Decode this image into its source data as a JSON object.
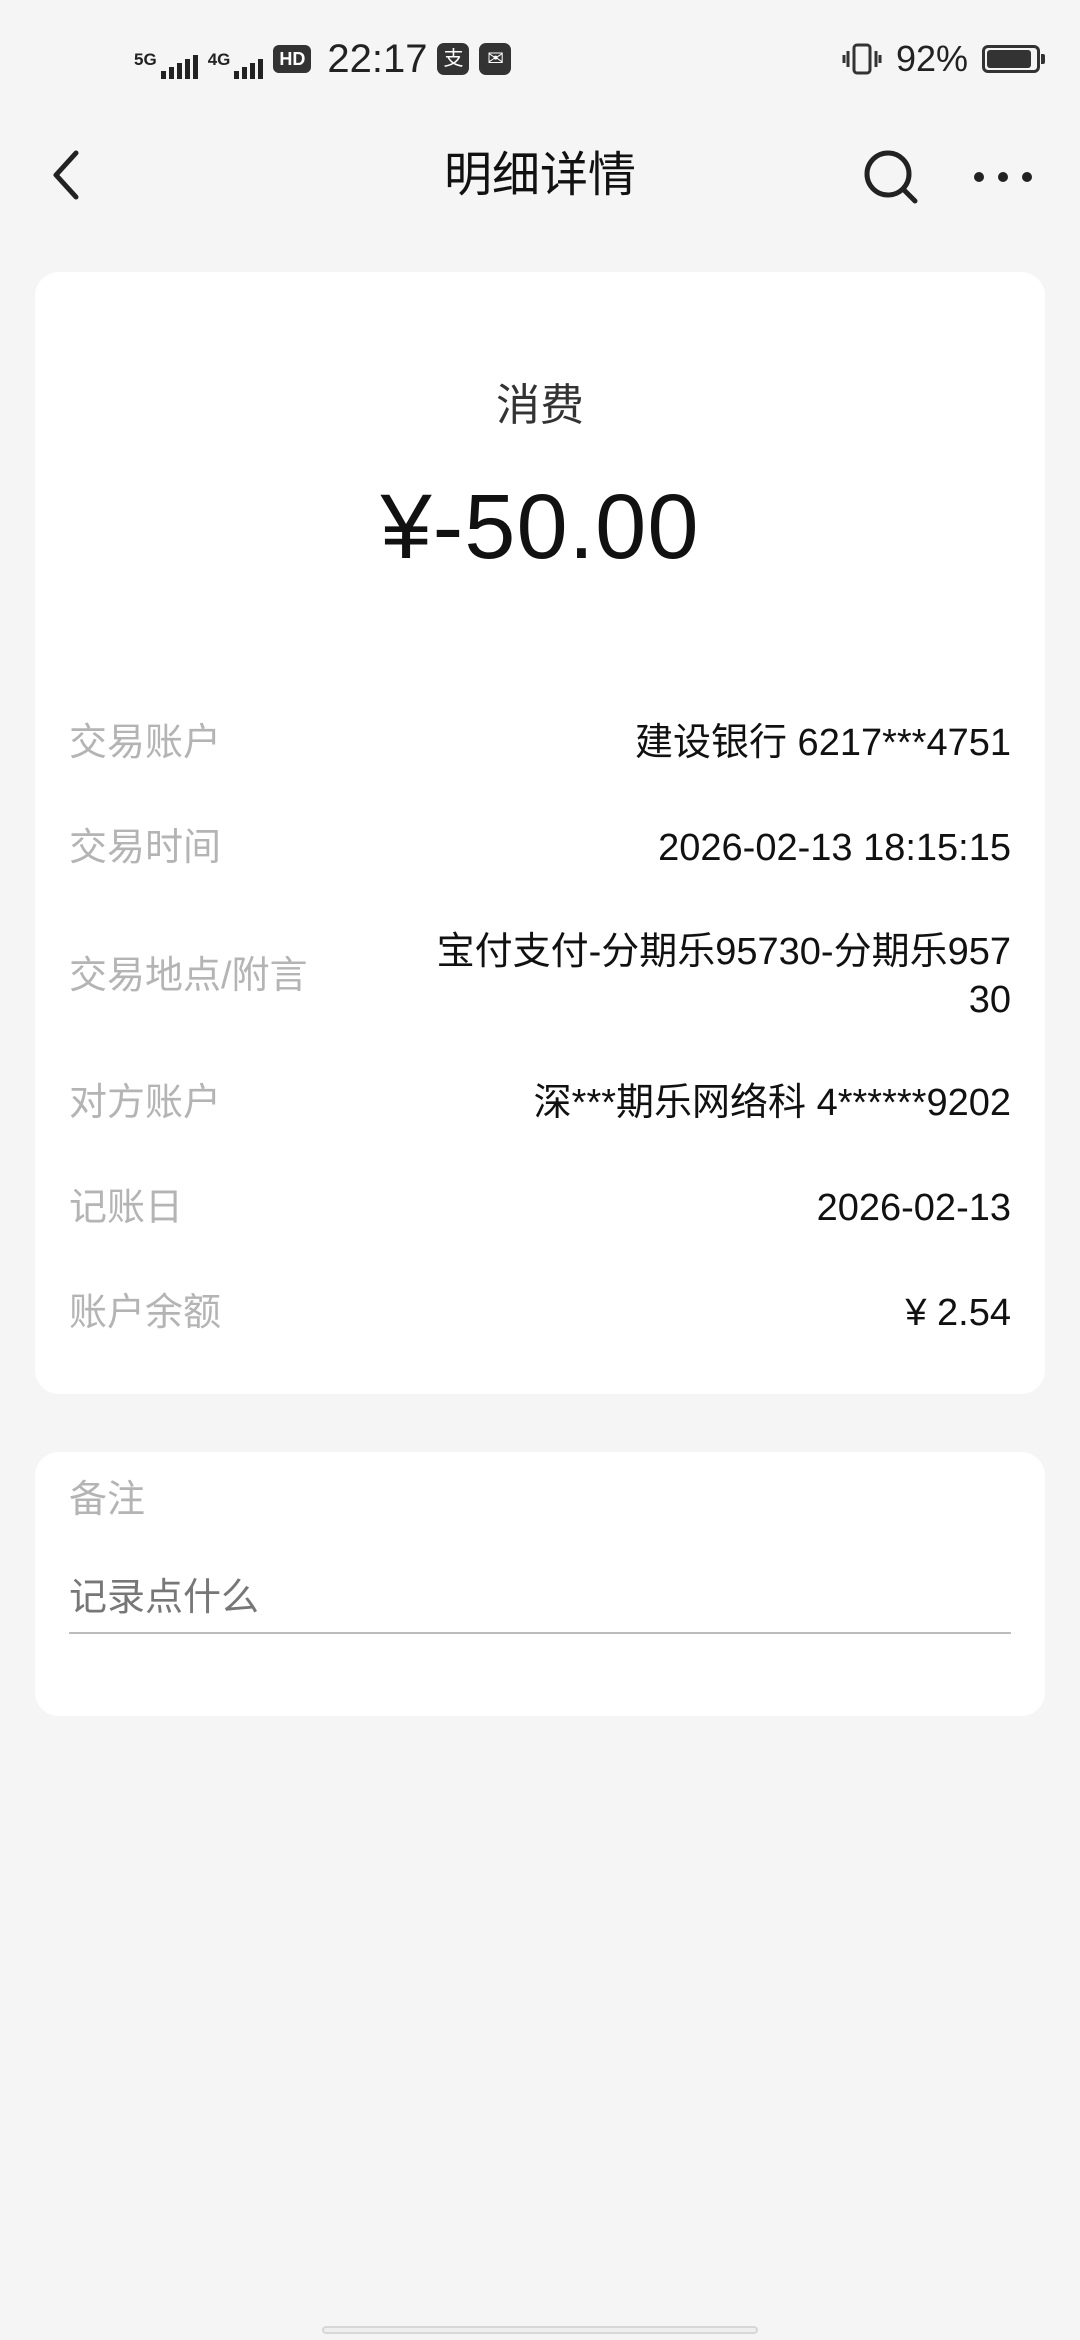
{
  "status_bar": {
    "network1": "5G",
    "network2": "4G",
    "hd": "HD",
    "time": "22:17",
    "app_badge1": "支",
    "app_badge2": "✉",
    "battery_percent": "92%",
    "battery_level": 0.92,
    "vibrate_icon": "vibrate-icon"
  },
  "nav": {
    "title": "明细详情",
    "back_icon": "chevron-left-icon",
    "search_icon": "search-icon",
    "more_icon": "more-dots-icon"
  },
  "transaction": {
    "type": "消费",
    "amount": "¥-50.00"
  },
  "details": [
    {
      "label": "交易账户",
      "value": "建设银行 6217***4751"
    },
    {
      "label": "交易时间",
      "value": "2026-02-13 18:15:15"
    },
    {
      "label": "交易地点/附言",
      "value_line1": "宝付支付-分期乐95730-分期乐957",
      "value_line2": "30"
    },
    {
      "label": "对方账户",
      "value": "深***期乐网络科 4******9202"
    },
    {
      "label": "记账日",
      "value": "2026-02-13"
    },
    {
      "label": "账户余额",
      "value": "¥ 2.54"
    }
  ],
  "remark": {
    "label": "备注",
    "placeholder": "记录点什么",
    "value": ""
  },
  "colors": {
    "background": "#f5f5f5",
    "card": "#ffffff",
    "label": "#b4b4b4",
    "text": "#111111"
  }
}
